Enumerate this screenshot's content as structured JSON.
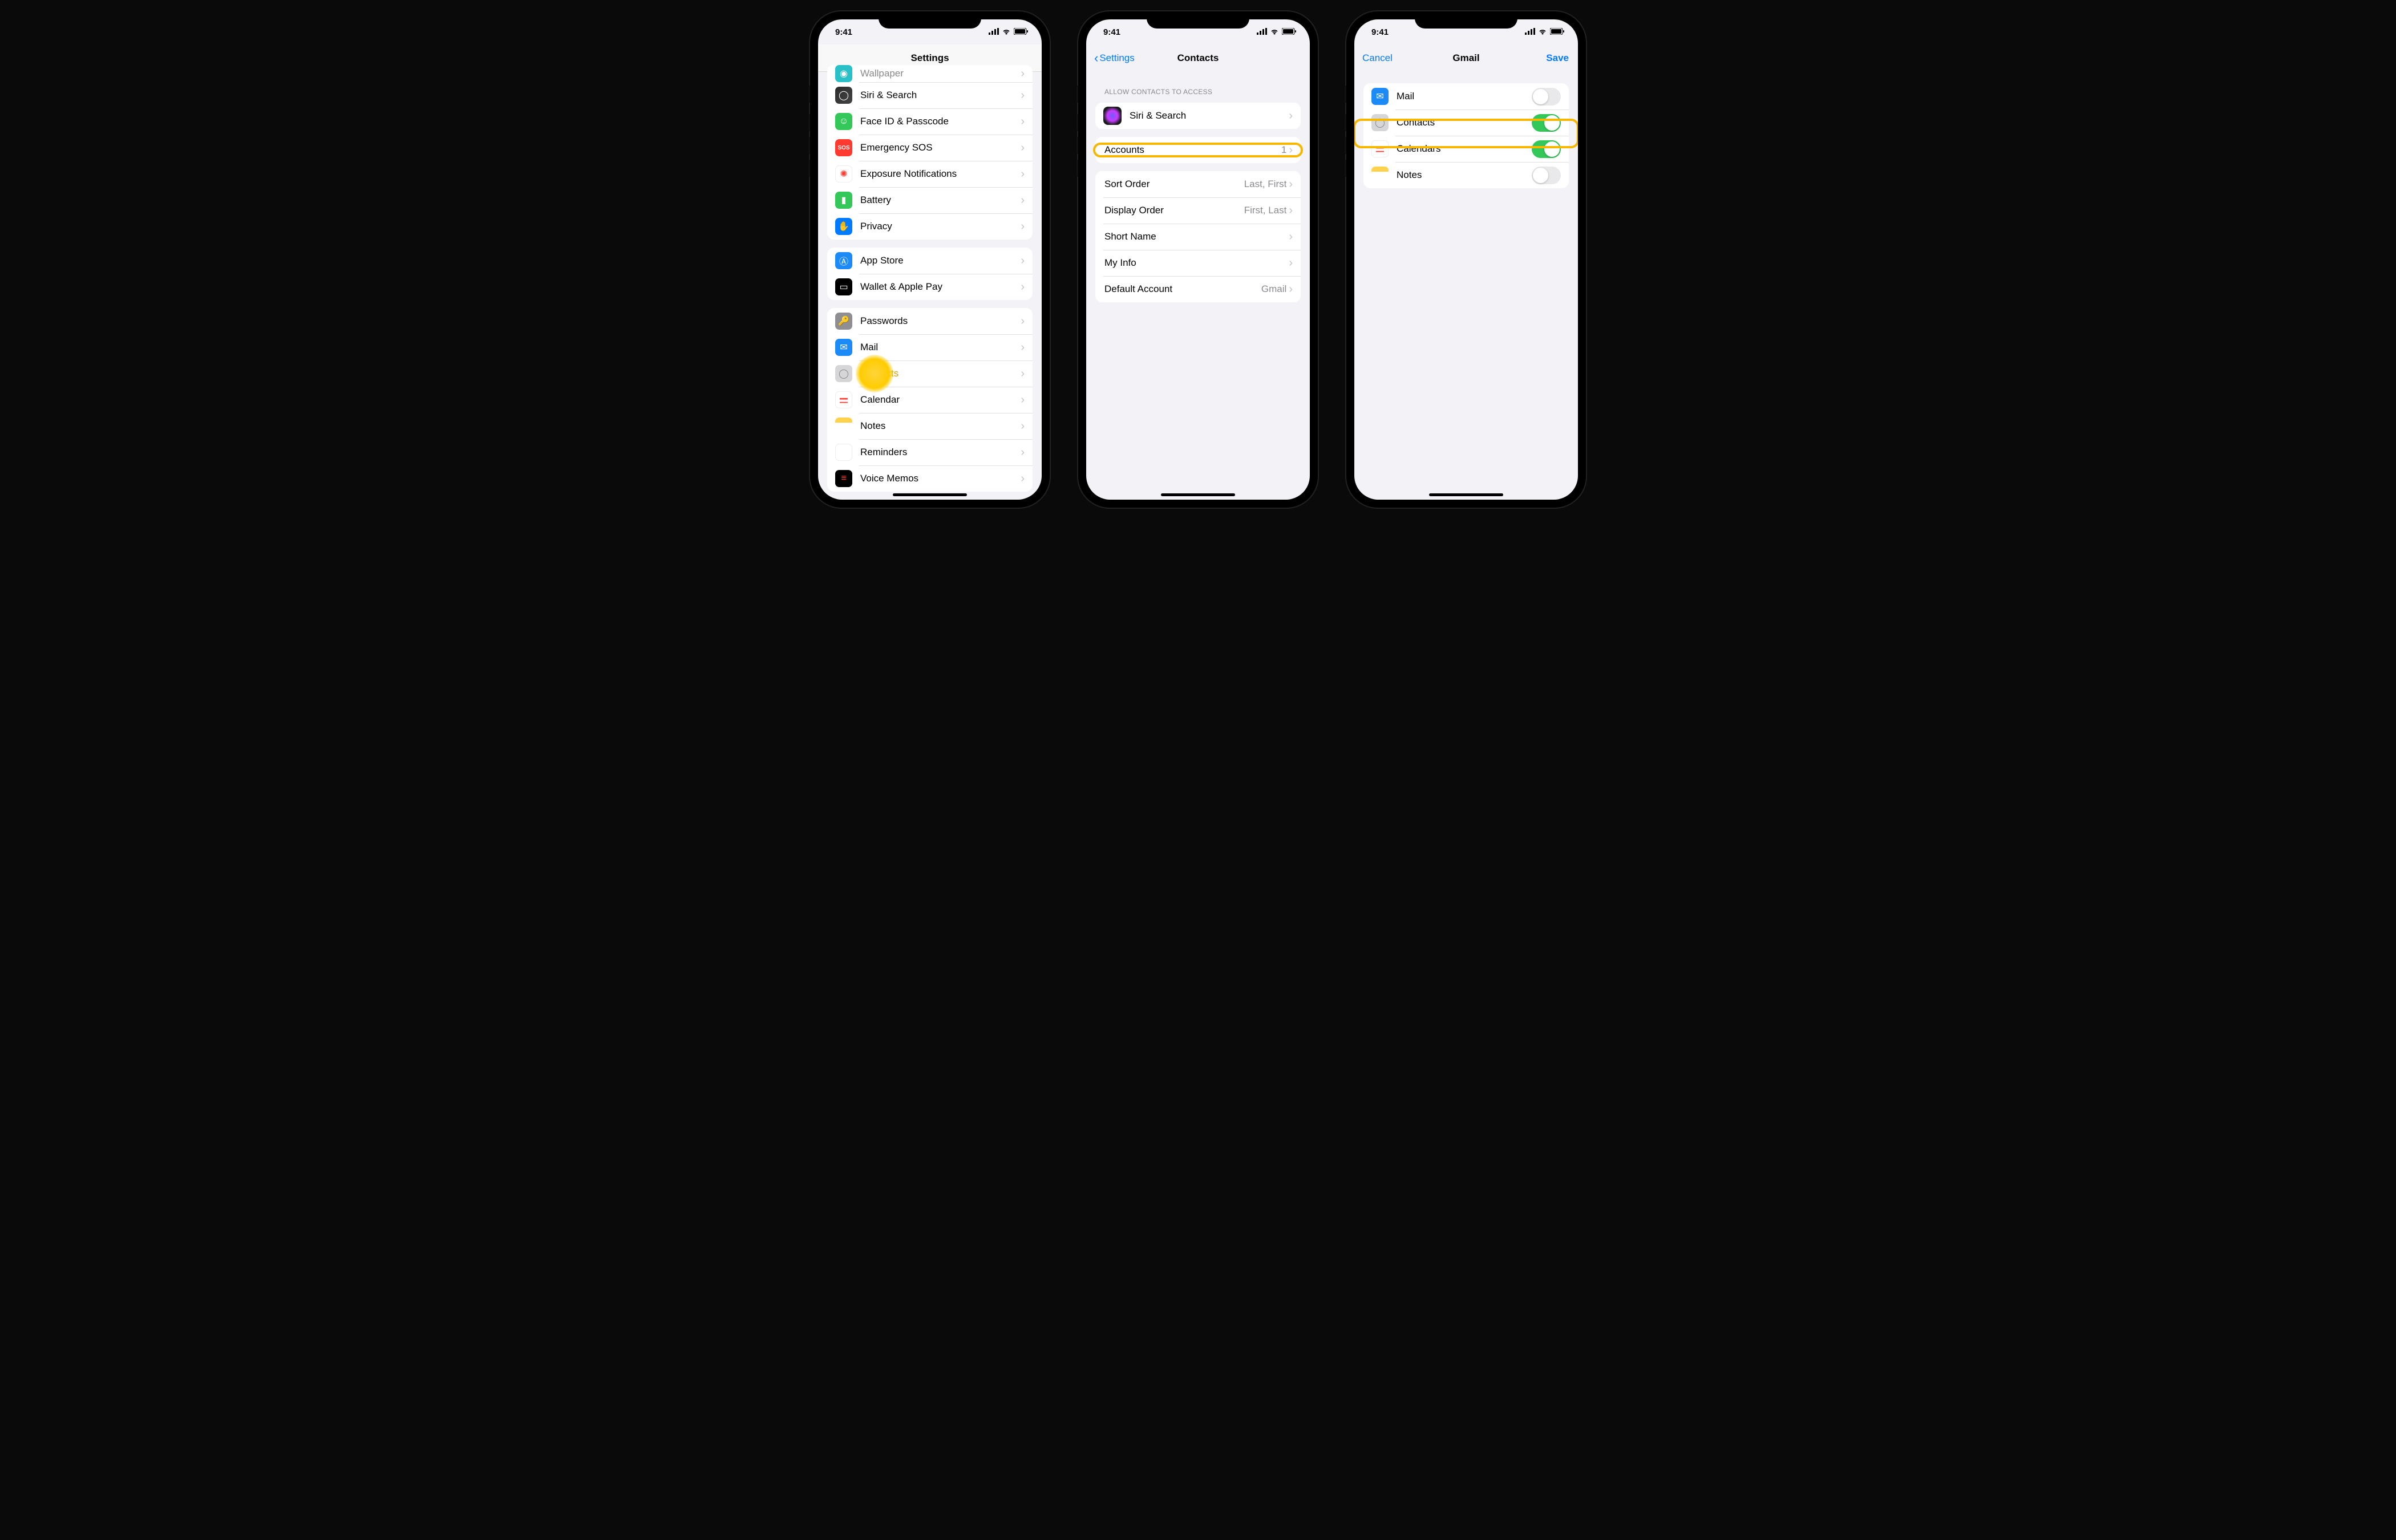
{
  "status": {
    "time": "9:41"
  },
  "phone1": {
    "title": "Settings",
    "groups": [
      {
        "rows": [
          {
            "icon": "wallpaper",
            "label": "Wallpaper"
          },
          {
            "icon": "siri",
            "label": "Siri & Search"
          },
          {
            "icon": "faceid",
            "label": "Face ID & Passcode"
          },
          {
            "icon": "sos",
            "label": "Emergency SOS"
          },
          {
            "icon": "exposure",
            "label": "Exposure Notifications"
          },
          {
            "icon": "battery",
            "label": "Battery"
          },
          {
            "icon": "privacy",
            "label": "Privacy"
          }
        ]
      },
      {
        "rows": [
          {
            "icon": "appstore",
            "label": "App Store"
          },
          {
            "icon": "wallet",
            "label": "Wallet & Apple Pay"
          }
        ]
      },
      {
        "rows": [
          {
            "icon": "passwords",
            "label": "Passwords"
          },
          {
            "icon": "mail",
            "label": "Mail"
          },
          {
            "icon": "contacts",
            "label": "Contacts",
            "highlighted": true
          },
          {
            "icon": "calendar",
            "label": "Calendar"
          },
          {
            "icon": "notes",
            "label": "Notes"
          },
          {
            "icon": "reminders",
            "label": "Reminders"
          },
          {
            "icon": "voicememos",
            "label": "Voice Memos"
          }
        ]
      }
    ]
  },
  "phone2": {
    "back": "Settings",
    "title": "Contacts",
    "section_header": "Allow Contacts to Access",
    "siri_row": {
      "label": "Siri & Search"
    },
    "accounts_row": {
      "label": "Accounts",
      "value": "1",
      "highlighted": true
    },
    "prefs": [
      {
        "label": "Sort Order",
        "value": "Last, First"
      },
      {
        "label": "Display Order",
        "value": "First, Last"
      },
      {
        "label": "Short Name",
        "value": ""
      },
      {
        "label": "My Info",
        "value": ""
      },
      {
        "label": "Default Account",
        "value": "Gmail"
      }
    ]
  },
  "phone3": {
    "cancel": "Cancel",
    "title": "Gmail",
    "save": "Save",
    "rows": [
      {
        "icon": "mail",
        "label": "Mail",
        "on": false
      },
      {
        "icon": "contacts",
        "label": "Contacts",
        "on": true,
        "highlighted": true
      },
      {
        "icon": "calendar",
        "label": "Calendars",
        "on": true
      },
      {
        "icon": "notes",
        "label": "Notes",
        "on": false
      }
    ]
  }
}
